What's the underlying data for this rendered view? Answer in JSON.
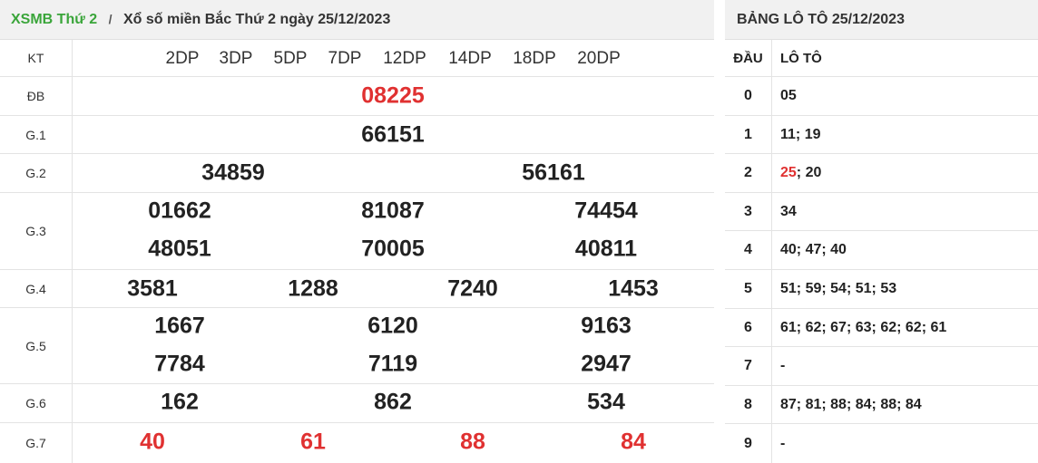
{
  "breadcrumb": {
    "home": "XSMB Thứ 2",
    "separator": "/",
    "title": "Xổ số miền Bắc Thứ 2 ngày 25/12/2023"
  },
  "results": {
    "kt_label": "KT",
    "kt_codes": [
      "2DP",
      "3DP",
      "5DP",
      "7DP",
      "12DP",
      "14DP",
      "18DP",
      "20DP"
    ],
    "db": {
      "label": "ĐB",
      "numbers": [
        "08225"
      ]
    },
    "g1": {
      "label": "G.1",
      "numbers": [
        "66151"
      ]
    },
    "g2": {
      "label": "G.2",
      "numbers": [
        "34859",
        "56161"
      ]
    },
    "g3": {
      "label": "G.3",
      "numbers": [
        "01662",
        "81087",
        "74454",
        "48051",
        "70005",
        "40811"
      ]
    },
    "g4": {
      "label": "G.4",
      "numbers": [
        "3581",
        "1288",
        "7240",
        "1453"
      ]
    },
    "g5": {
      "label": "G.5",
      "numbers": [
        "1667",
        "6120",
        "9163",
        "7784",
        "7119",
        "2947"
      ]
    },
    "g6": {
      "label": "G.6",
      "numbers": [
        "162",
        "862",
        "534"
      ]
    },
    "g7": {
      "label": "G.7",
      "numbers": [
        "40",
        "61",
        "88",
        "84"
      ]
    }
  },
  "colors": {
    "brand_green": "#3aa53a",
    "special_red": "#e03131",
    "header_bg": "#f1f1f1"
  },
  "loto": {
    "title": "BẢNG LÔ TÔ 25/12/2023",
    "col_dau": "ĐẦU",
    "col_loto": "LÔ TÔ",
    "rows": [
      {
        "dau": "0",
        "nums": [
          "05"
        ]
      },
      {
        "dau": "1",
        "nums": [
          "11",
          "19"
        ]
      },
      {
        "dau": "2",
        "nums": [
          "25",
          "20"
        ]
      },
      {
        "dau": "3",
        "nums": [
          "34"
        ]
      },
      {
        "dau": "4",
        "nums": [
          "40",
          "47",
          "40"
        ]
      },
      {
        "dau": "5",
        "nums": [
          "51",
          "59",
          "54",
          "51",
          "53"
        ]
      },
      {
        "dau": "6",
        "nums": [
          "61",
          "62",
          "67",
          "63",
          "62",
          "62",
          "61"
        ]
      },
      {
        "dau": "7",
        "nums": [
          "-"
        ]
      },
      {
        "dau": "8",
        "nums": [
          "87",
          "81",
          "88",
          "84",
          "88",
          "84"
        ]
      },
      {
        "dau": "9",
        "nums": [
          "-"
        ]
      }
    ],
    "separator": "; "
  }
}
